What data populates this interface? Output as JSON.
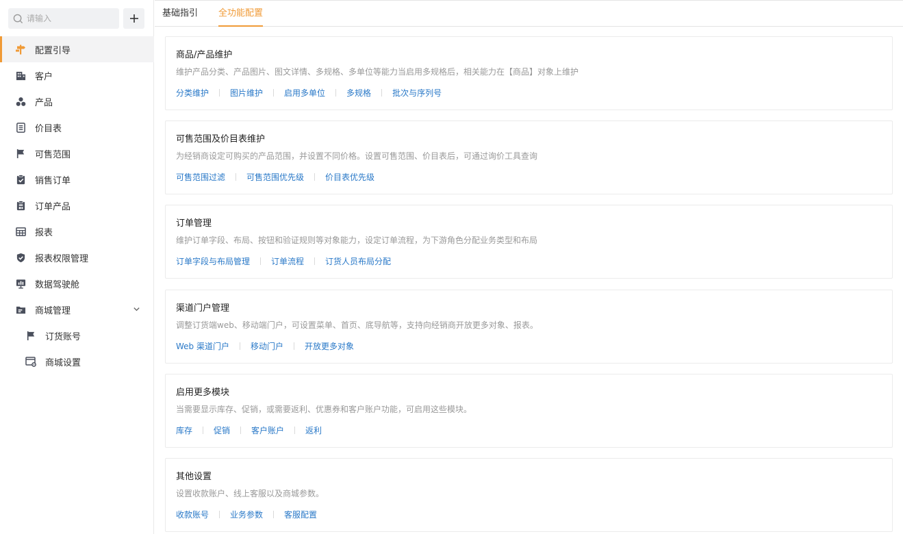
{
  "search": {
    "placeholder": "请输入"
  },
  "sidebar": {
    "items": [
      {
        "label": "配置引导",
        "icon": "signpost-icon"
      },
      {
        "label": "客户",
        "icon": "building-icon"
      },
      {
        "label": "产品",
        "icon": "cubes-icon"
      },
      {
        "label": "价目表",
        "icon": "document-list-icon"
      },
      {
        "label": "可售范围",
        "icon": "flag-icon"
      },
      {
        "label": "销售订单",
        "icon": "clipboard-check-icon"
      },
      {
        "label": "订单产品",
        "icon": "order-product-icon"
      },
      {
        "label": "报表",
        "icon": "table-icon"
      },
      {
        "label": "报表权限管理",
        "icon": "shield-check-icon"
      },
      {
        "label": "数据驾驶舱",
        "icon": "dashboard-icon"
      },
      {
        "label": "商城管理",
        "icon": "folder-icon"
      },
      {
        "label": "订货账号",
        "icon": "flag-icon"
      },
      {
        "label": "商城设置",
        "icon": "window-settings-icon"
      }
    ]
  },
  "tabs": [
    {
      "label": "基础指引"
    },
    {
      "label": "全功能配置"
    }
  ],
  "cards": [
    {
      "title": "商品/产品维护",
      "desc": "维护产品分类、产品图片、图文详情、多规格、多单位等能力当启用多规格后，相关能力在【商品】对象上维护",
      "links": [
        "分类维护",
        "图片维护",
        "启用多单位",
        "多规格",
        "批次与序列号"
      ]
    },
    {
      "title": "可售范围及价目表维护",
      "desc": "为经销商设定可购买的产品范围，并设置不同价格。设置可售范围、价目表后，可通过询价工具查询",
      "links": [
        "可售范围过滤",
        "可售范围优先级",
        "价目表优先级"
      ]
    },
    {
      "title": "订单管理",
      "desc": "维护订单字段、布局、按钮和验证规则等对象能力，设定订单流程，为下游角色分配业务类型和布局",
      "links": [
        "订单字段与布局管理",
        "订单流程",
        "订货人员布局分配"
      ]
    },
    {
      "title": "渠道门户管理",
      "desc": "调整订货端web、移动端门户，可设置菜单、首页、底导航等，支持向经销商开放更多对象、报表。",
      "links": [
        "Web 渠道门户",
        "移动门户",
        "开放更多对象"
      ]
    },
    {
      "title": "启用更多模块",
      "desc": "当需要显示库存、促销，或需要返利、优惠券和客户账户功能，可启用这些模块。",
      "links": [
        "库存",
        "促销",
        "客户账户",
        "返利"
      ]
    },
    {
      "title": "其他设置",
      "desc": "设置收款账户、线上客服以及商城参数。",
      "links": [
        "收款账号",
        "业务参数",
        "客服配置"
      ]
    }
  ],
  "colors": {
    "accent": "#f09a36",
    "link": "#2a79c8",
    "icon": "#4a4f5c"
  }
}
